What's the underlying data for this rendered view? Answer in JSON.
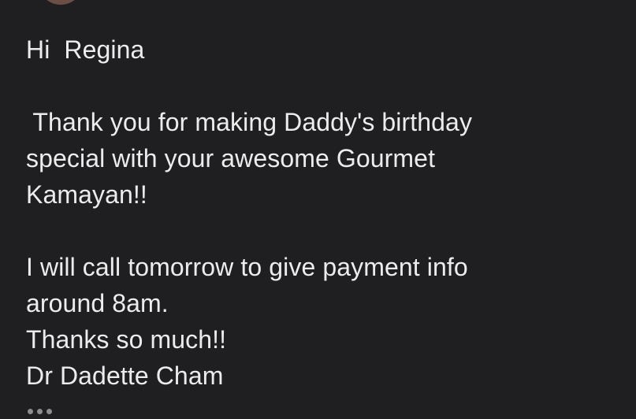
{
  "message": {
    "greeting": "Hi  Regina",
    "paragraph1": [
      " Thank you for making Daddy's birthday",
      "special with your awesome Gourmet",
      "Kamayan!!"
    ],
    "paragraph2": [
      "I will call tomorrow to give payment info",
      "around 8am."
    ],
    "closing": "Thanks so much!!",
    "signature": "Dr Dadette Cham"
  },
  "icons": {
    "avatar": "avatar",
    "more": "more-dots-icon"
  },
  "colors": {
    "background": "#1f1f22",
    "text": "#ececec",
    "dots": "#8d8d90",
    "avatar": "#6b4f47"
  }
}
